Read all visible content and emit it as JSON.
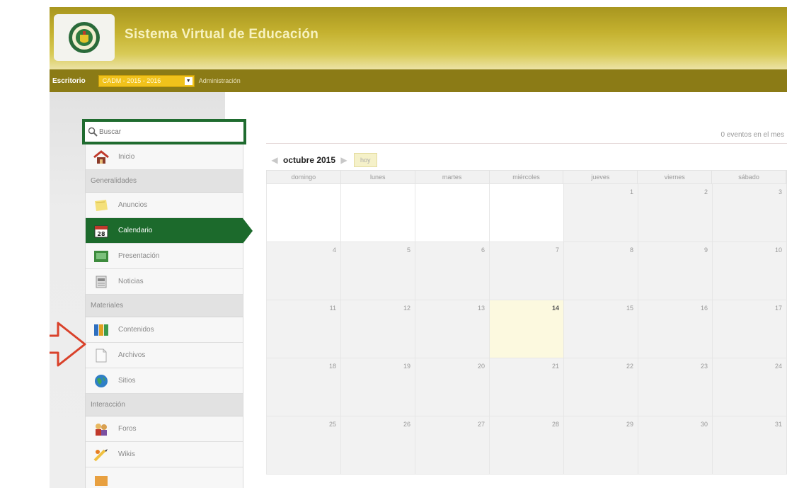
{
  "header": {
    "title": "Sistema Virtual de Educación"
  },
  "navbar": {
    "escritorio": "Escritorio",
    "period_select": "CADM - 2015 - 2016",
    "admin": "Administración"
  },
  "sidebar": {
    "search_placeholder": "Buscar",
    "items": [
      {
        "type": "item",
        "label": "Inicio",
        "icon": "home-icon"
      },
      {
        "type": "section",
        "label": "Generalidades"
      },
      {
        "type": "item",
        "label": "Anuncios",
        "icon": "announcement-icon"
      },
      {
        "type": "item",
        "label": "Calendario",
        "icon": "calendar-icon",
        "active": true
      },
      {
        "type": "item",
        "label": "Presentación",
        "icon": "presentation-icon"
      },
      {
        "type": "item",
        "label": "Noticias",
        "icon": "news-icon"
      },
      {
        "type": "section",
        "label": "Materiales"
      },
      {
        "type": "item",
        "label": "Contenidos",
        "icon": "contents-icon"
      },
      {
        "type": "item",
        "label": "Archivos",
        "icon": "file-icon"
      },
      {
        "type": "item",
        "label": "Sitios",
        "icon": "globe-icon"
      },
      {
        "type": "section",
        "label": "Interacción"
      },
      {
        "type": "item",
        "label": "Foros",
        "icon": "forum-icon"
      },
      {
        "type": "item",
        "label": "Wikis",
        "icon": "wiki-icon"
      },
      {
        "type": "item",
        "label": "",
        "icon": "blog-icon"
      }
    ]
  },
  "calendar": {
    "events_count": "0 eventos en el mes",
    "month_title": "octubre 2015",
    "today_label": "hoy",
    "weekdays": [
      "domingo",
      "lunes",
      "martes",
      "miércoles",
      "jueves",
      "viernes",
      "sábado"
    ],
    "leading_blanks": 4,
    "days_in_month": 31,
    "today": 14
  },
  "colors": {
    "header_gold": "#c4b12f",
    "navbar": "#8b7b16",
    "accent_green": "#1c6a2c",
    "select_yellow": "#f0c21b",
    "annotation_red": "#d9412a"
  }
}
